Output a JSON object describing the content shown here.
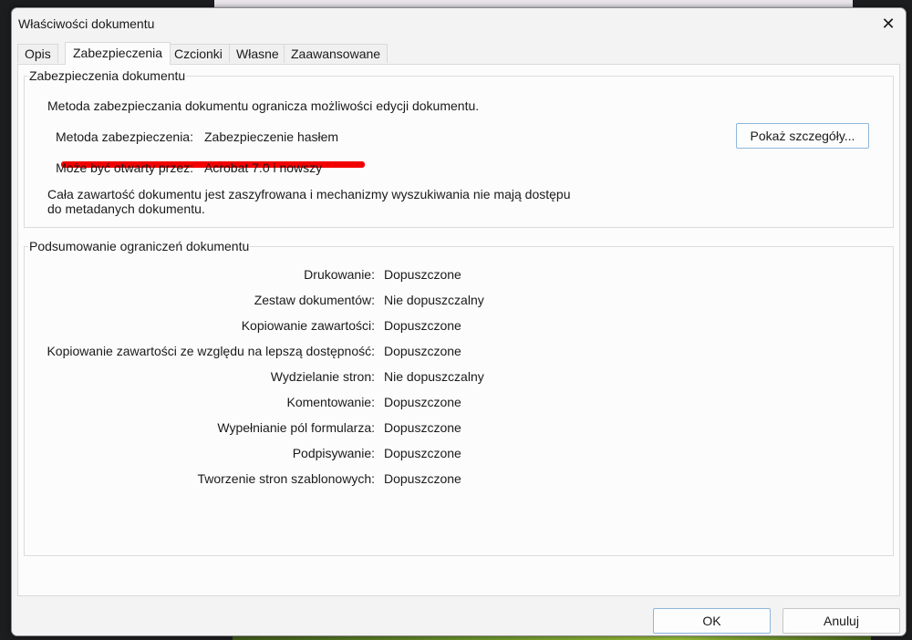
{
  "window": {
    "title": "Właściwości dokumentu",
    "close_glyph": "✕"
  },
  "tabs": [
    {
      "label": "Opis"
    },
    {
      "label": "Zabezpieczenia"
    },
    {
      "label": "Czcionki"
    },
    {
      "label": "Własne"
    },
    {
      "label": "Zaawansowane"
    }
  ],
  "security": {
    "group_title": "Zabezpieczenia dokumentu",
    "description": "Metoda zabezpieczania dokumentu ogranicza możliwości edycji dokumentu.",
    "method_label": "Metoda zabezpieczenia:",
    "method_value": "Zabezpieczenie hasłem",
    "open_label": "Może być otwarty przez:",
    "open_value": "Acrobat 7.0 i nowszy",
    "note_line1": "Cała zawartość dokumentu jest zaszyfrowana i mechanizmy wyszukiwania nie mają dostępu",
    "note_line2": "do metadanych dokumentu.",
    "details_button": "Pokaż szczegóły...",
    "highlight_color": "#f20000"
  },
  "restrictions": {
    "group_title": "Podsumowanie ograniczeń dokumentu",
    "rows": [
      {
        "label": "Drukowanie:",
        "value": "Dopuszczone"
      },
      {
        "label": "Zestaw dokumentów:",
        "value": "Nie dopuszczalny"
      },
      {
        "label": "Kopiowanie zawartości:",
        "value": "Dopuszczone"
      },
      {
        "label": "Kopiowanie zawartości ze względu na lepszą dostępność:",
        "value": "Dopuszczone"
      },
      {
        "label": "Wydzielanie stron:",
        "value": "Nie dopuszczalny"
      },
      {
        "label": "Komentowanie:",
        "value": "Dopuszczone"
      },
      {
        "label": "Wypełnianie pól formularza:",
        "value": "Dopuszczone"
      },
      {
        "label": "Podpisywanie:",
        "value": "Dopuszczone"
      },
      {
        "label": "Tworzenie stron szablonowych:",
        "value": "Dopuszczone"
      }
    ]
  },
  "footer": {
    "ok_label": "OK",
    "cancel_label": "Anuluj"
  }
}
